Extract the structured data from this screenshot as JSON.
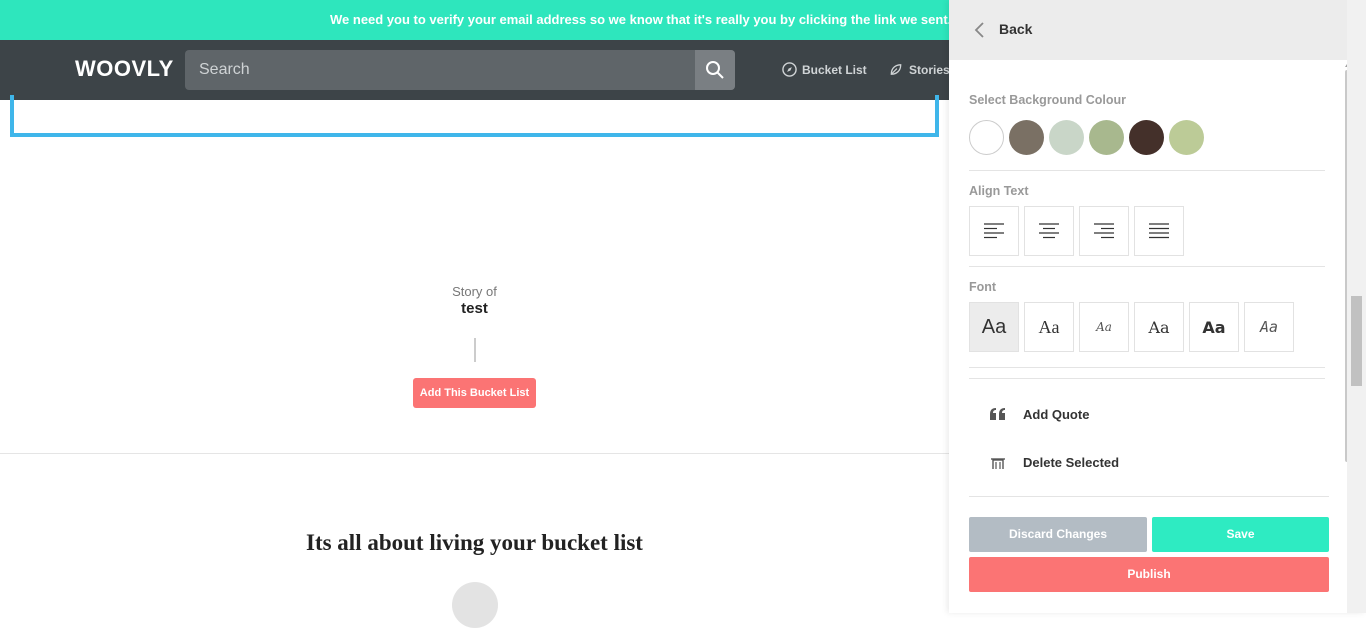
{
  "banner": {
    "text": "We need you to verify your email address so we know that it's really you by clicking the link we sent.   Sen"
  },
  "navbar": {
    "logo": "WOOVLY",
    "search_placeholder": "Search",
    "links": [
      "Bucket List",
      "Stories"
    ]
  },
  "main": {
    "story_of": "Story of",
    "story_name": "test",
    "add_button": "Add This Bucket List",
    "tagline": "Its all about living your bucket list"
  },
  "panel": {
    "back": "Back",
    "bg_label": "Select Background Colour",
    "swatches": [
      "#ffffff",
      "#7a7064",
      "#c9d6c8",
      "#a8b88e",
      "#44302a",
      "#bccb97"
    ],
    "align_label": "Align Text",
    "align_options": [
      "align-left",
      "align-center",
      "align-right",
      "align-justify"
    ],
    "font_label": "Font",
    "font_samples": [
      "Aa",
      "Aa",
      "Aa",
      "Aa",
      "Aa",
      "Aa"
    ],
    "add_quote": "Add Quote",
    "delete_selected": "Delete Selected",
    "discard": "Discard Changes",
    "save": "Save",
    "publish": "Publish"
  },
  "colors": {
    "accent_teal": "#2ee6bd",
    "accent_red": "#fb7474",
    "nav_bg": "#3d4448",
    "box_border": "#3fb6ea"
  }
}
